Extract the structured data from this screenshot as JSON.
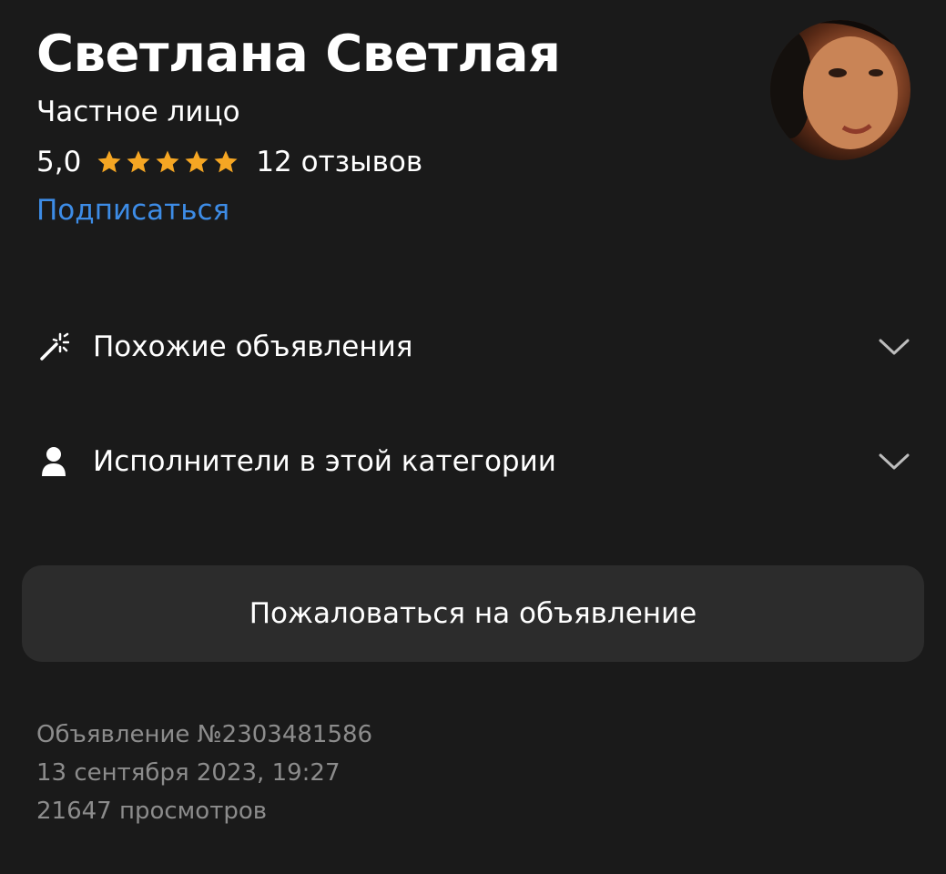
{
  "seller": {
    "name": "Светлана Светлая",
    "type": "Частное лицо",
    "rating": "5,0",
    "stars": 5,
    "star_color": "#f5a623",
    "reviews": "12 отзывов",
    "subscribe_label": "Подписаться",
    "subscribe_color": "#3d8ce6",
    "avatar_icon": "profile-photo"
  },
  "menu": {
    "similar": {
      "label": "Похожие объявления",
      "icon": "magic-wand-icon"
    },
    "performers": {
      "label": "Исполнители в этой категории",
      "icon": "person-icon"
    }
  },
  "report_button": {
    "label": "Пожаловаться на объявление"
  },
  "ad_meta": {
    "number": "Объявление №2303481586",
    "date": "13 сентября 2023, 19:27",
    "views": "21647 просмотров"
  },
  "colors": {
    "background": "#1a1a1a",
    "button_bg": "#2c2c2c",
    "meta_text": "#8c8c8c"
  }
}
